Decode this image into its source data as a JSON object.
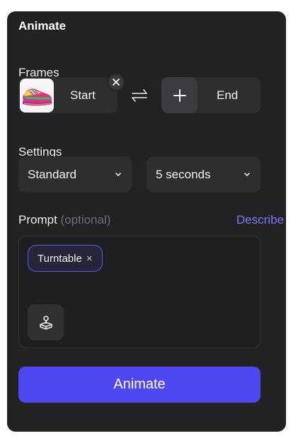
{
  "panel": {
    "title": "Animate"
  },
  "frames": {
    "label": "Frames",
    "start_label": "Start",
    "end_label": "End",
    "start_thumbnail_icon": "sneaker-image",
    "remove_icon": "close-icon",
    "swap_icon": "swap-arrows-icon",
    "add_icon": "plus-icon"
  },
  "settings": {
    "label": "Settings",
    "quality_value": "Standard",
    "duration_value": "5 seconds",
    "dropdown_icon": "chevron-down-icon"
  },
  "prompt": {
    "label": "Prompt",
    "optional_hint": "(optional)",
    "describe_link": "Describe",
    "chips": [
      {
        "label": "Turntable",
        "remove_glyph": "×"
      }
    ],
    "camera_icon": "camera-motion-icon"
  },
  "action": {
    "animate_label": "Animate"
  },
  "colors": {
    "panel_bg": "#222224",
    "accent": "#4f48f0",
    "link": "#7b78f5",
    "chip_border": "#5b57f0"
  }
}
